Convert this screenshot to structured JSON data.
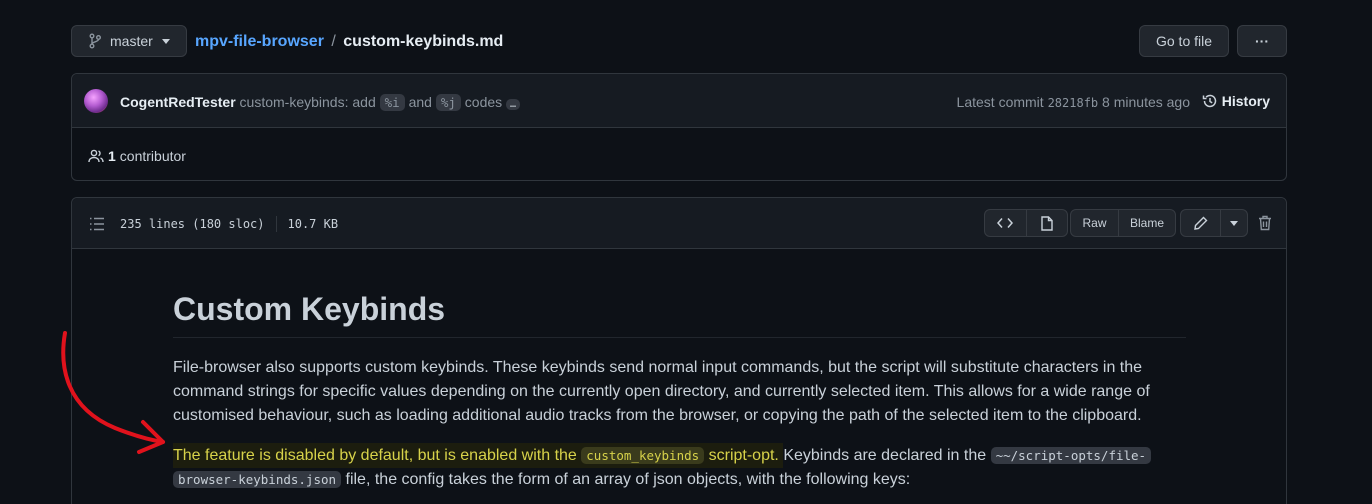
{
  "header": {
    "branch": "master",
    "repo": "mpv-file-browser",
    "separator": "/",
    "file": "custom-keybinds.md",
    "go_to_file": "Go to file",
    "more": "···"
  },
  "commit": {
    "author": "CogentRedTester",
    "message_prefix": "custom-keybinds: add",
    "code1": "%i",
    "and": "and",
    "code2": "%j",
    "codes": "codes",
    "ellipsis": "…",
    "latest_label": "Latest commit",
    "sha": "28218fb",
    "time": "8 minutes ago",
    "history": "History"
  },
  "contributors": {
    "count": "1",
    "label": "contributor"
  },
  "file_toolbar": {
    "lines": "235 lines (180 sloc)",
    "size": "10.7 KB",
    "raw": "Raw",
    "blame": "Blame"
  },
  "content": {
    "heading": "Custom Keybinds",
    "para1": "File-browser also supports custom keybinds. These keybinds send normal input commands, but the script will substitute characters in the command strings for specific values depending on the currently open directory, and currently selected item. This allows for a wide range of customised behaviour, such as loading additional audio tracks from the browser, or copying the path of the selected item to the clipboard.",
    "p2_highlight": "The feature is disabled by default, but is enabled with the",
    "p2_code1": "custom_keybinds",
    "p2_hl_end": "script-opt.",
    "p2_mid": "Keybinds are declared in the",
    "p2_code2a": "~~/script-opts/file-",
    "p2_code2b": "browser-keybinds.json",
    "p2_end": "file, the config takes the form of an array of json objects, with the following keys:"
  },
  "colors": {
    "link": "#58a6ff",
    "highlight_text": "#d7d24a",
    "annotation": "#e0121c"
  }
}
